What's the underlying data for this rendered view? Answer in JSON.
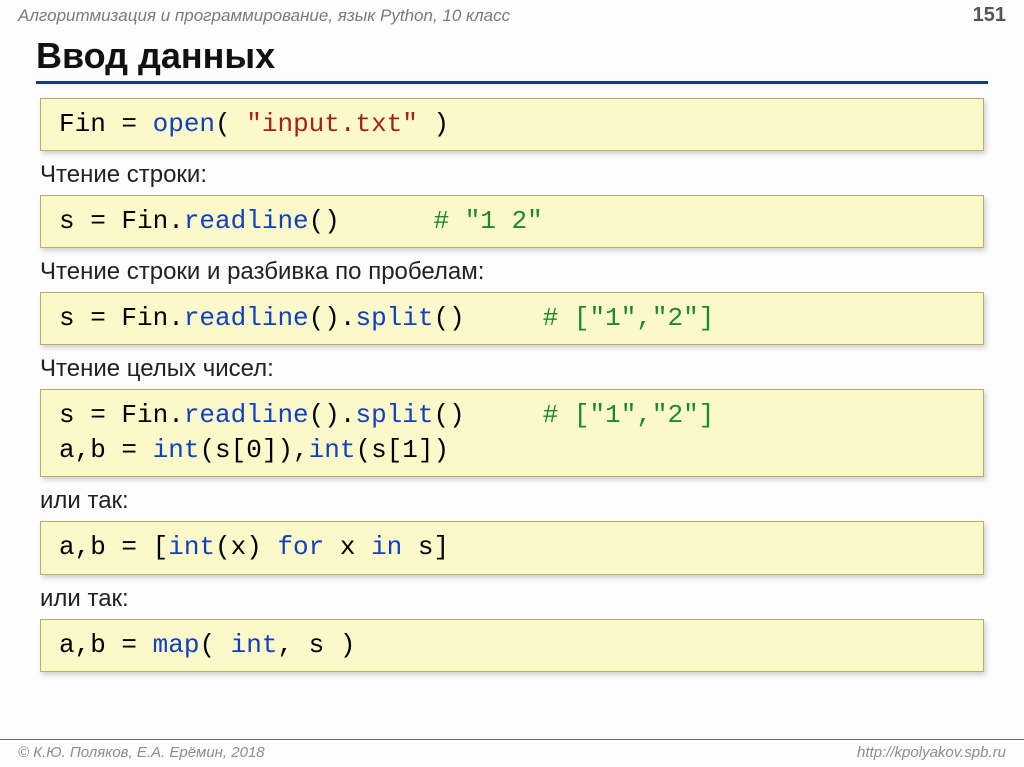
{
  "header": {
    "course_title": "Алгоритмизация и программирование, язык Python, 10 класс",
    "page_number": "151"
  },
  "slide": {
    "title": "Ввод данных",
    "block1": {
      "code": [
        {
          "t": "Fin = "
        },
        {
          "t": "open",
          "c": "fn"
        },
        {
          "t": "( "
        },
        {
          "t": "\"input.txt\"",
          "c": "str"
        },
        {
          "t": " )"
        }
      ]
    },
    "label1": "Чтение строки:",
    "block2": {
      "code": [
        {
          "t": "s = Fin."
        },
        {
          "t": "readline",
          "c": "fn"
        },
        {
          "t": "()      "
        },
        {
          "t": "# \"1 2\"",
          "c": "cm"
        }
      ]
    },
    "label2": "Чтение строки и разбивка по пробелам:",
    "block3": {
      "code": [
        {
          "t": "s = Fin."
        },
        {
          "t": "readline",
          "c": "fn"
        },
        {
          "t": "()."
        },
        {
          "t": "split",
          "c": "fn"
        },
        {
          "t": "()     "
        },
        {
          "t": "# [\"1\",\"2\"]",
          "c": "cm"
        }
      ]
    },
    "label3": "Чтение целых чисел:",
    "block4": {
      "code": [
        {
          "t": "s = Fin."
        },
        {
          "t": "readline",
          "c": "fn"
        },
        {
          "t": "()."
        },
        {
          "t": "split",
          "c": "fn"
        },
        {
          "t": "()     "
        },
        {
          "t": "# [\"1\",\"2\"]",
          "c": "cm"
        },
        {
          "t": "\n"
        },
        {
          "t": "a,b = "
        },
        {
          "t": "int",
          "c": "fn"
        },
        {
          "t": "(s[0]),"
        },
        {
          "t": "int",
          "c": "fn"
        },
        {
          "t": "(s[1])"
        }
      ]
    },
    "label4": "или так:",
    "block5": {
      "code": [
        {
          "t": "a,b = ["
        },
        {
          "t": "int",
          "c": "fn"
        },
        {
          "t": "(x) "
        },
        {
          "t": "for",
          "c": "kw"
        },
        {
          "t": " x "
        },
        {
          "t": "in",
          "c": "kw"
        },
        {
          "t": " s]"
        }
      ]
    },
    "label5": "или так:",
    "block6": {
      "code": [
        {
          "t": "a,b = "
        },
        {
          "t": "map",
          "c": "fn"
        },
        {
          "t": "( "
        },
        {
          "t": "int",
          "c": "fn"
        },
        {
          "t": ", s )"
        }
      ]
    }
  },
  "footer": {
    "left": "© К.Ю. Поляков, Е.А. Ерёмин, 2018",
    "right": "http://kpolyakov.spb.ru"
  }
}
